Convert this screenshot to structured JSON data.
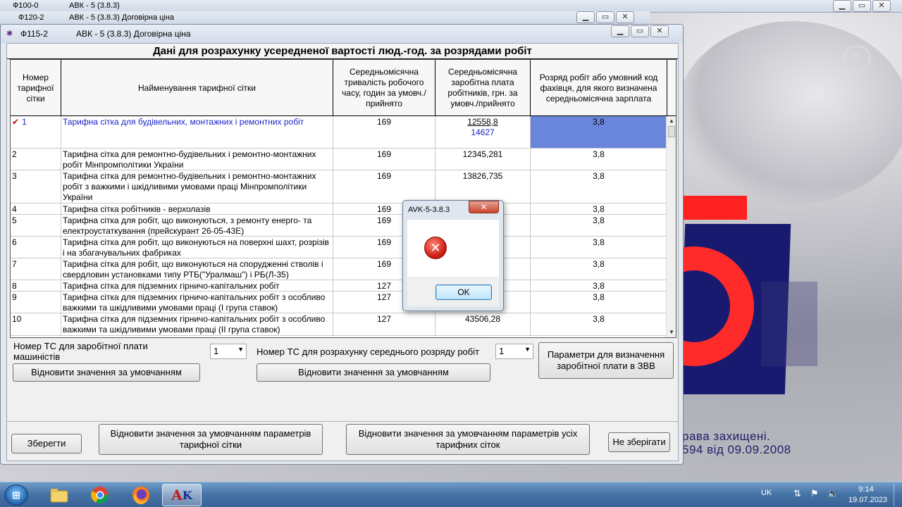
{
  "desktop": {
    "bg_text_line1": "рава захищені.",
    "bg_text_line2": "594 від 09.09.2008"
  },
  "background_windows": [
    {
      "form": "Ф100-0",
      "title": "АВК - 5 (3.8.3)"
    },
    {
      "form": "Ф120-2",
      "title": "АВК - 5 (3.8.3)  Договірна ціна"
    }
  ],
  "main_window": {
    "form": "Ф115-2",
    "title": "АВК - 5 (3.8.3)  Договірна ціна",
    "heading": "Дані для розрахунку усередненої вартості люд.-год. за розрядами робіт",
    "columns": [
      "Номер тарифної сітки",
      "Найменування тарифної сітки",
      "Середньомісячна тривалість робочого часу, годин за умовч./прийнято",
      "Середньомісячна заробітна плата робітників, грн. за умовч./прийнято",
      "Розряд робіт або умовний код фахівця, для якого визначена середньомісячна зарплата"
    ],
    "rows": [
      {
        "num": "1",
        "name": "Тарифна сітка для будівельних, монтажних і ремонтних робіт",
        "hours": "169",
        "salary": "12558,8",
        "salary2": "14627",
        "grade": "3,8"
      },
      {
        "num": "2",
        "name": "Тарифна сітка для ремонтно-будівельних і ремонтно-монтажних робіт Мінпромполітики України",
        "hours": "169",
        "salary": "12345,281",
        "grade": "3,8"
      },
      {
        "num": "3",
        "name": "Тарифна сітка для ремонтно-будівельних і ремонтно-монтажних робіт з важкими і шкідливими умовами праці Мінпромполітики України",
        "hours": "169",
        "salary": "13826,735",
        "grade": "3,8"
      },
      {
        "num": "4",
        "name": "Тарифна сітка робітників - верхолазів",
        "hours": "169",
        "salary": "",
        "grade": "3,8"
      },
      {
        "num": "5",
        "name": "Тарифна сітка для робіт, що виконуються, з ремонту енерго- та електроустаткування (прейскурант 26-05-43Е)",
        "hours": "169",
        "salary": "",
        "grade": "3,8"
      },
      {
        "num": "6",
        "name": "Тарифна сітка для робіт, що виконуються на поверхні шахт, розрізів і на збагачувальних фабриках",
        "hours": "169",
        "salary": "",
        "grade": "3,8"
      },
      {
        "num": "7",
        "name": "Тарифна сітка для робіт, що виконуються на спорудженні стволів і свердловин установками типу РТБ(\"Уралмаш\") і РБ(Л-35)",
        "hours": "169",
        "salary": "",
        "grade": "3,8"
      },
      {
        "num": "8",
        "name": "Тарифна сітка для підземних гірничо-капітальних робіт",
        "hours": "127",
        "salary": "",
        "grade": "3,8"
      },
      {
        "num": "9",
        "name": "Тарифна сітка для підземних гірничо-капітальних робіт з особливо важкими та шкідливими умовами праці (І група ставок)",
        "hours": "127",
        "salary": "",
        "grade": "3,8"
      },
      {
        "num": "10",
        "name": "Тарифна сітка для підземних гірничо-капітальних робіт з особливо важкими та шкідливими умовами праці (ІІ група ставок)",
        "hours": "127",
        "salary": "43506,28",
        "grade": "3,8"
      }
    ],
    "machinist_label": "Номер ТС для заробітної плати машиністів",
    "machinist_value": "1",
    "avg_grade_label": "Номер ТС для розрахунку середнього розряду робіт",
    "avg_grade_value": "1",
    "restore_defaults": "Відновити значення за умовчанням",
    "restore_defaults2": "Відновити значення за умовчанням",
    "params_zvv": "Параметри для визначення заробітної плати в ЗВВ",
    "save": "Зберегти",
    "restore_grid": "Відновити значення за умовчанням параметрів тарифної сітки",
    "restore_all": "Відновити значення за умовчанням параметрів усіх тарифних сіток",
    "dont_save": "Не зберігати"
  },
  "dialog": {
    "title": "AVK-5-3.8.3",
    "ok": "OK"
  },
  "taskbar": {
    "lang": "UK",
    "time": "9:14",
    "date": "19.07.2023"
  }
}
